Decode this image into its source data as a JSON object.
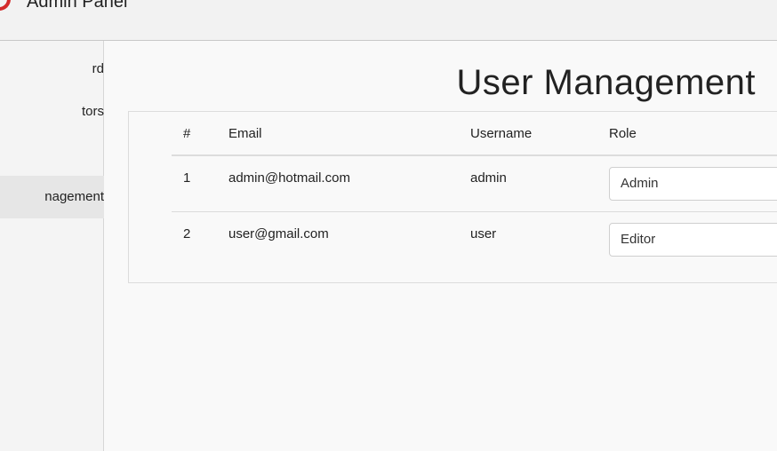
{
  "header": {
    "app_title": "Admin Panel"
  },
  "sidebar": {
    "items": [
      {
        "label": "Dashboard",
        "visible": "rd"
      },
      {
        "label": "Editors",
        "visible": "tors"
      },
      {
        "label": "",
        "visible": ""
      },
      {
        "label": "User Management",
        "visible": "nagement",
        "active": true
      }
    ]
  },
  "main": {
    "page_title": "User Management",
    "table": {
      "headers": {
        "num": "#",
        "email": "Email",
        "username": "Username",
        "role": "Role"
      },
      "rows": [
        {
          "num": "1",
          "email": "admin@hotmail.com",
          "username": "admin",
          "role": "Admin"
        },
        {
          "num": "2",
          "email": "user@gmail.com",
          "username": "user",
          "role": "Editor"
        }
      ]
    }
  },
  "colors": {
    "accent": "#d32a2a",
    "active_bg": "#e6e6e6"
  }
}
